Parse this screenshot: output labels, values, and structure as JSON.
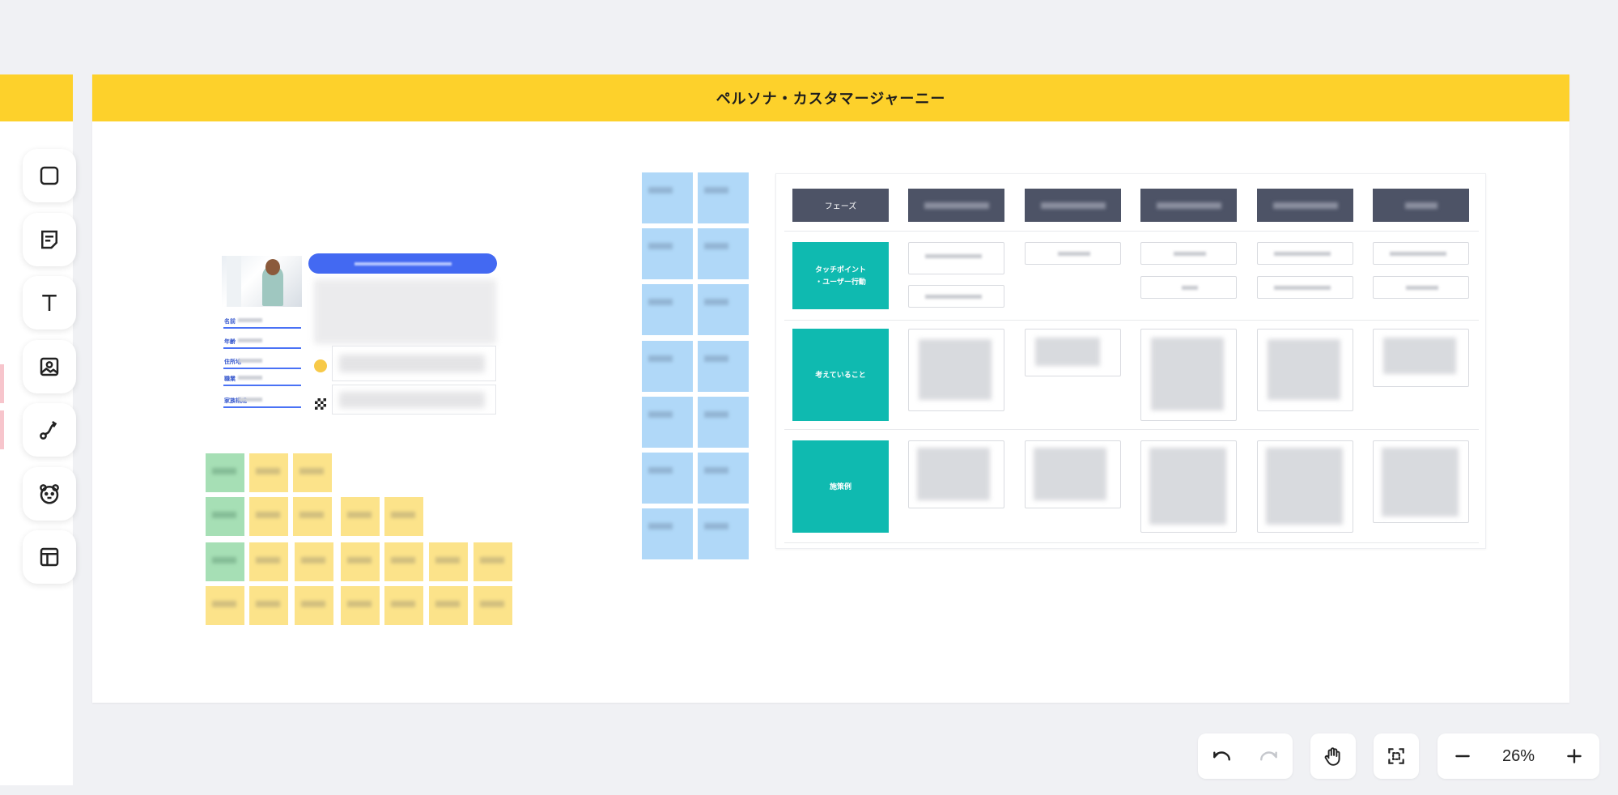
{
  "board": {
    "frame_title": "ペルソナ・カスタマージャーニー"
  },
  "toolbar": {
    "tools": [
      "shape-tool",
      "sticky-note-tool",
      "text-tool",
      "image-tool",
      "connector-tool",
      "stamp-tool",
      "template-tool"
    ]
  },
  "journey": {
    "phase_header": "フェーズ",
    "rows": [
      "タッチポイント\n・ユーザー行動",
      "考えていること",
      "施策例"
    ]
  },
  "controls": {
    "zoom_level": "26%"
  }
}
